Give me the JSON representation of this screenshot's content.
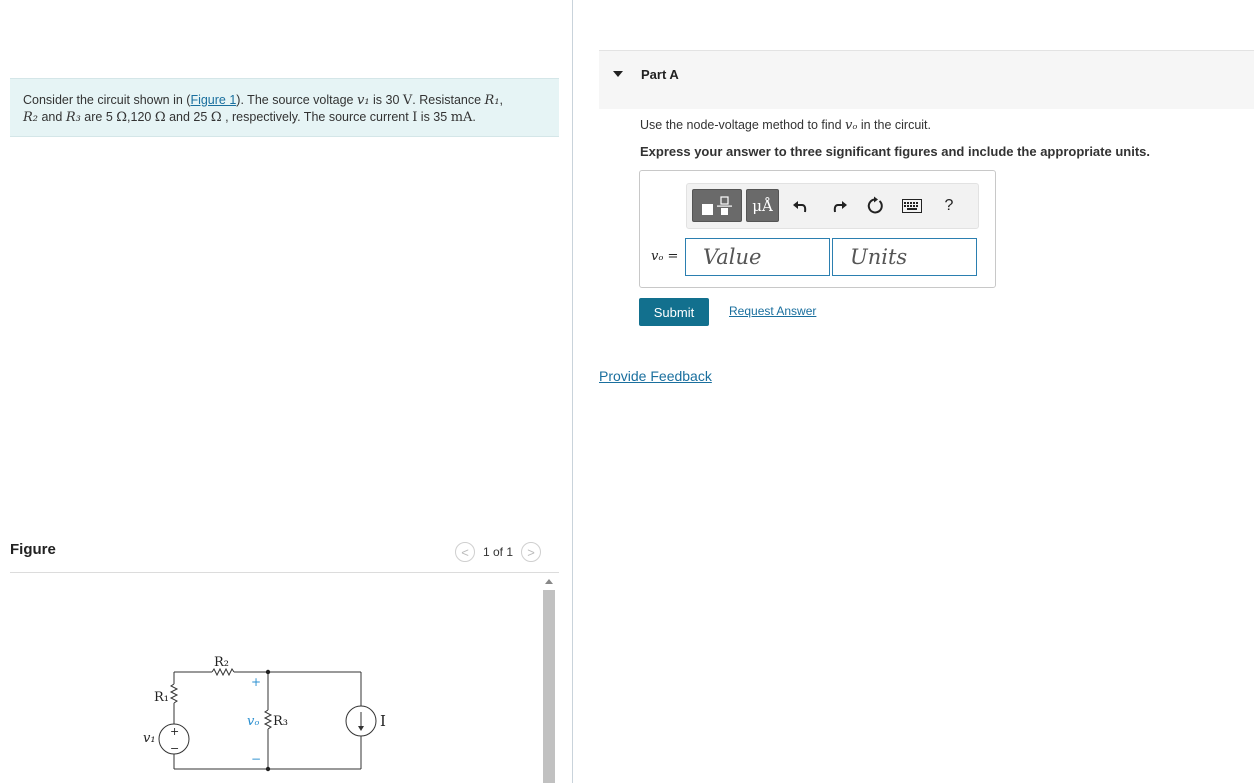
{
  "problem": {
    "intro": "Consider the circuit shown in (",
    "figure_link": "Figure 1",
    "t1": "). The source voltage ",
    "v1_var": "v₁",
    "t2": " is 30 ",
    "unit_V": "V",
    "t3": ". Resistance ",
    "r1_var": "R₁",
    "t4": ",",
    "r2_var": "R₂",
    "t5": " and ",
    "r3_var": "R₃",
    "t6": " are 5 ",
    "ohm1": "Ω",
    "t7": ",120 ",
    "ohm2": "Ω",
    "t8": " and 25 ",
    "ohm3": "Ω",
    "t9": " , respectively. The source current ",
    "i_var": "I",
    "t10": " is 35 ",
    "unit_mA": "mA",
    "t11": "."
  },
  "figure": {
    "title": "Figure",
    "pager": "1 of 1",
    "prev": "<",
    "next": ">",
    "labels": {
      "r1": "R₁",
      "r2": "R₂",
      "r3": "R₃",
      "v1": "v₁",
      "vo": "vₒ",
      "i": "I",
      "plus": "+",
      "minus": "−"
    }
  },
  "part": {
    "title": "Part A",
    "instruction_pre": "Use the node-voltage method to find ",
    "instruction_var": "vₒ",
    "instruction_post": " in the circuit.",
    "express": "Express your answer to three significant figures and include the appropriate units."
  },
  "answer": {
    "var_label": "vₒ =",
    "value_placeholder": "Value",
    "units_placeholder": "Units",
    "units_button": "μÅ",
    "help_icon": "?"
  },
  "actions": {
    "submit": "Submit",
    "request_answer": "Request Answer",
    "provide_feedback": "Provide Feedback"
  },
  "colors": {
    "accent": "#12708e",
    "link": "#1a6f9e",
    "problem_bg": "#e6f4f5",
    "input_border": "#2b7fb0"
  }
}
